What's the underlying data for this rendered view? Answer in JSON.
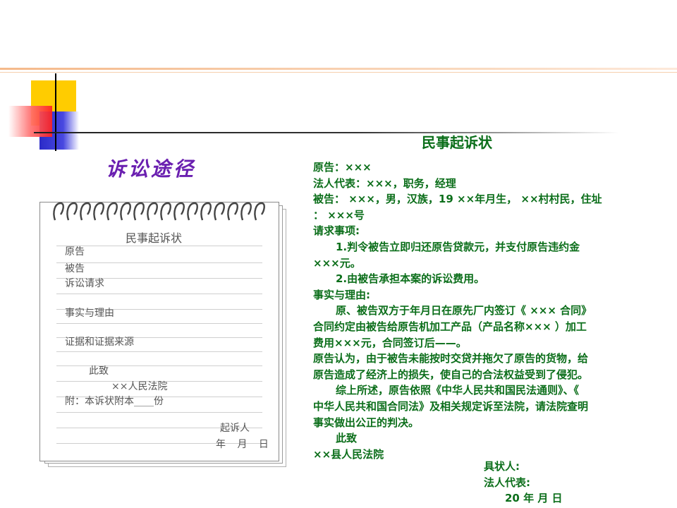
{
  "left_title": "诉讼途径",
  "notebook": {
    "heading": "民事起诉状",
    "fields": [
      "原告",
      "被告",
      "诉讼请求",
      "事实与理由",
      "证据和证据来源"
    ],
    "closing": "此致",
    "court": "××人民法院",
    "attachment": "附：本诉状附本____份",
    "signer": "起诉人",
    "date": "年 月 日"
  },
  "document": {
    "title": "民事起诉状",
    "lines": [
      {
        "text": "原告：×××",
        "indent": false
      },
      {
        "text": "法人代表：×××，职务，经理",
        "indent": false
      },
      {
        "text": "被告： ×××，男，汉族，19 ××年月生， ××村村民，住址",
        "indent": false
      },
      {
        "text": "： ×××号",
        "indent": false
      },
      {
        "text": "请求事项:",
        "indent": false
      },
      {
        "text": "1.判令被告立即归还原告贷款元，并支付原告违约金",
        "indent": true
      },
      {
        "text": "×××元。",
        "indent": false
      },
      {
        "text": "2.由被告承担本案的诉讼费用。",
        "indent": true
      },
      {
        "text": "事实与理由:",
        "indent": false
      },
      {
        "text": "原、被告双方于年月日在原先厂内签订《 ××× 合同》",
        "indent": true
      },
      {
        "text": "合同约定由被告给原告机加工产品（产品名称××× ）加工",
        "indent": false
      },
      {
        "text": "费用×××元，合同签订后——。",
        "indent": false
      },
      {
        "text": "原告认为，由于被告未能按时交贷并拖欠了原告的货物，给",
        "indent": false
      },
      {
        "text": "原告造成了经济上的损失，使自己的合法权益受到了侵犯。",
        "indent": false
      },
      {
        "text": "综上所述，原告依照《中华人民共和国民法通则》、《",
        "indent": true
      },
      {
        "text": "中华人民共和国合同法》及相关规定诉至法院，请法院查明",
        "indent": false
      },
      {
        "text": "事实做出公正的判决。",
        "indent": false
      },
      {
        "text": "此致",
        "indent": true
      },
      {
        "text": "××县人民法院",
        "indent": false
      }
    ],
    "signature": {
      "plaintiff": "具状人:",
      "representative": "法人代表:",
      "date": "20  年 月 日"
    }
  },
  "colors": {
    "text_green": "#0b6e1a",
    "title_purple": "#6a1fb0",
    "accent_yellow": "#ffcc00",
    "accent_blue": "#2b2bc8",
    "accent_red": "#ff2020"
  }
}
